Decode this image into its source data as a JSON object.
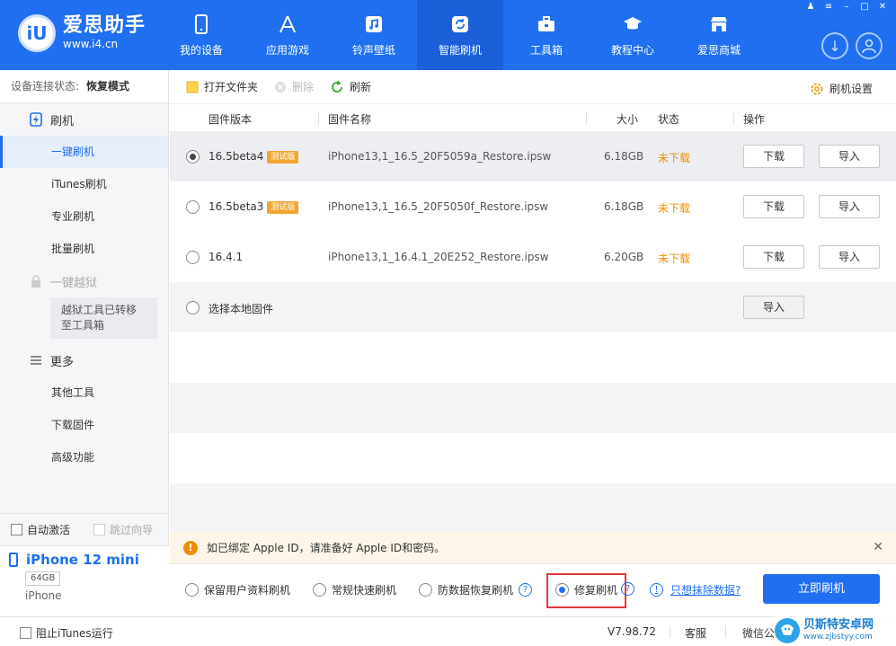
{
  "app": {
    "name": "爱思助手",
    "url": "www.i4.cn",
    "logo_mark": "iU"
  },
  "nav": [
    {
      "label": "我的设备",
      "icon": "phone-icon"
    },
    {
      "label": "应用游戏",
      "icon": "apps-icon"
    },
    {
      "label": "铃声壁纸",
      "icon": "music-icon"
    },
    {
      "label": "智能刷机",
      "icon": "refresh-icon",
      "active": true
    },
    {
      "label": "工具箱",
      "icon": "toolbox-icon"
    },
    {
      "label": "教程中心",
      "icon": "graduation-cap-icon"
    },
    {
      "label": "爱思商城",
      "icon": "store-icon"
    }
  ],
  "sidebar": {
    "status_label": "设备连接状态:",
    "status_value": "恢复模式",
    "flash_group": "刷机",
    "items": [
      "一键刷机",
      "iTunes刷机",
      "专业刷机",
      "批量刷机"
    ],
    "jailbreak_group": "一键越狱",
    "jailbreak_note": "越狱工具已转移至工具箱",
    "more_group": "更多",
    "more_items": [
      "其他工具",
      "下载固件",
      "高级功能"
    ],
    "auto_activate": "自动激活",
    "skip_guide": "跳过向导"
  },
  "device": {
    "name": "iPhone 12 mini",
    "capacity": "64GB",
    "type": "iPhone"
  },
  "toolbar": {
    "open_folder": "打开文件夹",
    "delete": "删除",
    "refresh": "刷新",
    "settings": "刷机设置"
  },
  "table": {
    "headers": [
      "固件版本",
      "固件名称",
      "大小",
      "状态",
      "操作"
    ],
    "rows": [
      {
        "version": "16.5beta4",
        "badge": "测试版",
        "name": "iPhone13,1_16.5_20F5059a_Restore.ipsw",
        "size": "6.18GB",
        "status": "未下载",
        "download": "下载",
        "import": "导入",
        "selected": true
      },
      {
        "version": "16.5beta3",
        "badge": "测试版",
        "name": "iPhone13,1_16.5_20F5050f_Restore.ipsw",
        "size": "6.18GB",
        "status": "未下载",
        "download": "下载",
        "import": "导入"
      },
      {
        "version": "16.4.1",
        "badge": "",
        "name": "iPhone13,1_16.4.1_20E252_Restore.ipsw",
        "size": "6.20GB",
        "status": "未下载",
        "download": "下载",
        "import": "导入"
      }
    ],
    "local": {
      "label": "选择本地固件",
      "import": "导入"
    }
  },
  "notice": {
    "text": "如已绑定 Apple ID，请准备好 Apple ID和密码。"
  },
  "modes": {
    "options": [
      "保留用户资料刷机",
      "常规快速刷机",
      "防数据恢复刷机",
      "修复刷机"
    ],
    "selected_index": 3,
    "erase_link": "只想抹除数据?",
    "flash_now": "立即刷机"
  },
  "footer": {
    "block_itunes": "阻止iTunes运行",
    "version": "V7.98.72",
    "service": "客服",
    "wechat": "微信公"
  },
  "watermark": {
    "title": "贝斯特安卓网",
    "url": "www.zjbstyy.com"
  },
  "colors": {
    "brand": "#1f6ff0",
    "warning": "#f08c00",
    "beta_badge": "#f3a533",
    "highlight": "#e03a3a"
  }
}
